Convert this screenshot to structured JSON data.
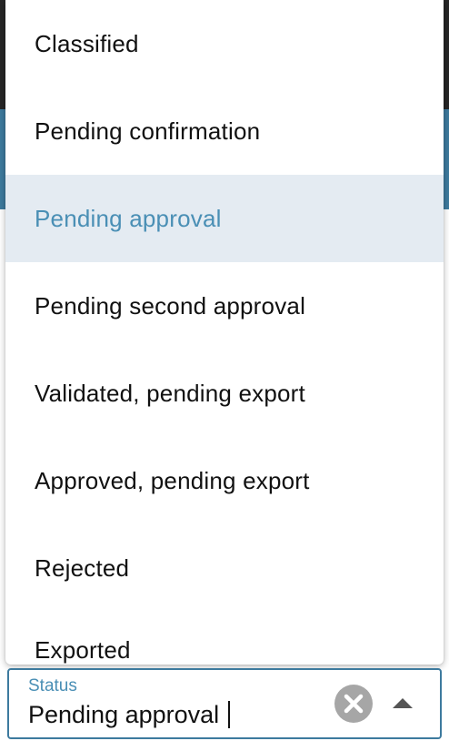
{
  "dropdown": {
    "options": [
      {
        "label": "Classified"
      },
      {
        "label": "Pending confirmation"
      },
      {
        "label": "Pending approval"
      },
      {
        "label": "Pending second approval"
      },
      {
        "label": "Validated, pending export"
      },
      {
        "label": "Approved, pending export"
      },
      {
        "label": "Rejected"
      },
      {
        "label": "Exported"
      }
    ],
    "selected_label": "Pending approval"
  },
  "status_field": {
    "label": "Status",
    "value": "Pending approval",
    "clear_icon": "clear-circle-icon",
    "toggle_icon": "caret-up-icon"
  },
  "colors": {
    "accent": "#3d7a9e",
    "selected_text": "#4a8fb5",
    "selected_background": "#e4ebf2",
    "top_bar": "#262626"
  }
}
